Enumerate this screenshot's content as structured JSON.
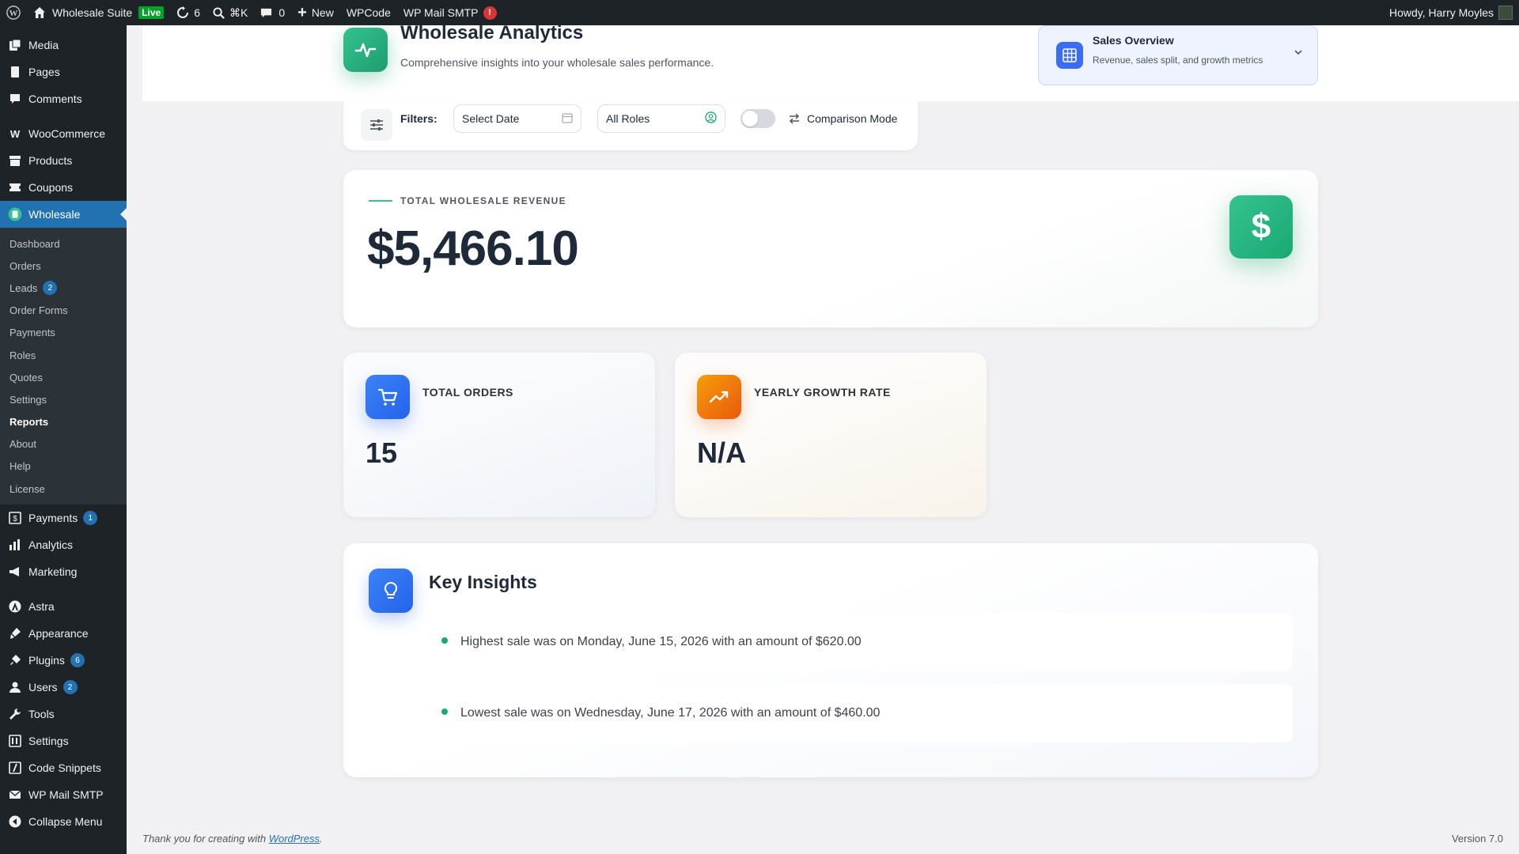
{
  "adminbar": {
    "site_name": "Wholesale Suite",
    "live_badge": "Live",
    "updates_count": "6",
    "shortcut": "⌘K",
    "comments_count": "0",
    "new_label": "New",
    "wpcode_label": "WPCode",
    "smtp_label": "WP Mail SMTP",
    "smtp_alert": "!",
    "howdy": "Howdy, Harry Moyles"
  },
  "sidebar": {
    "items_top": [
      {
        "label": "Media",
        "icon": "media-icon"
      },
      {
        "label": "Pages",
        "icon": "pages-icon"
      },
      {
        "label": "Comments",
        "icon": "comments-icon"
      }
    ],
    "items_woo": [
      {
        "label": "WooCommerce",
        "icon": "woocommerce-icon"
      },
      {
        "label": "Products",
        "icon": "products-icon"
      },
      {
        "label": "Coupons",
        "icon": "coupons-icon"
      }
    ],
    "wholesale_label": "Wholesale",
    "submenu": [
      {
        "label": "Dashboard"
      },
      {
        "label": "Orders"
      },
      {
        "label": "Leads",
        "count": "2"
      },
      {
        "label": "Order Forms"
      },
      {
        "label": "Payments"
      },
      {
        "label": "Roles"
      },
      {
        "label": "Quotes"
      },
      {
        "label": "Settings"
      },
      {
        "label": "Reports"
      },
      {
        "label": "About"
      },
      {
        "label": "Help"
      },
      {
        "label": "License"
      }
    ],
    "payments_label": "Payments",
    "payments_count": "1",
    "analytics_label": "Analytics",
    "marketing_label": "Marketing",
    "astra_label": "Astra",
    "appearance_label": "Appearance",
    "plugins_label": "Plugins",
    "plugins_count": "6",
    "users_label": "Users",
    "users_count": "2",
    "tools_label": "Tools",
    "settings_label": "Settings",
    "snippets_label": "Code Snippets",
    "smtp_label": "WP Mail SMTP",
    "collapse_label": "Collapse Menu"
  },
  "header": {
    "title": "Wholesale Analytics",
    "subtitle": "Comprehensive insights into your wholesale sales performance.",
    "overview_title": "Sales Overview",
    "overview_sub": "Revenue, sales split, and growth metrics"
  },
  "filters": {
    "label": "Filters:",
    "date_placeholder": "Select Date",
    "role_value": "All Roles",
    "comparison_label": "Comparison Mode",
    "comparison_on": false
  },
  "revenue": {
    "label": "TOTAL WHOLESALE REVENUE",
    "value": "$5,466.10",
    "icon": "$"
  },
  "stats": {
    "orders_label": "TOTAL ORDERS",
    "orders_value": "15",
    "growth_label": "YEARLY GROWTH RATE",
    "growth_value": "N/A"
  },
  "insights": {
    "title": "Key Insights",
    "items": [
      "Highest sale was on Monday, June 15, 2026 with an amount of $620.00",
      "Lowest sale was on Wednesday, June 17, 2026 with an amount of $460.00"
    ]
  },
  "footer": {
    "thanks_prefix": "Thank you for creating with ",
    "wp_link": "WordPress",
    "thanks_suffix": ".",
    "version": "Version 7.0"
  },
  "colors": {
    "accent_green": "#1aa873",
    "accent_blue": "#2563eb",
    "accent_orange": "#ea580c",
    "wp_blue": "#2271b1",
    "admin_dark": "#1d2327"
  }
}
